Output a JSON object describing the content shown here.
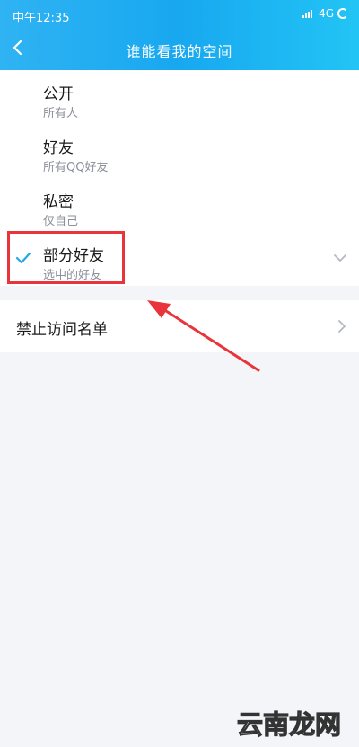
{
  "status_bar": {
    "time": "中午12:35",
    "network": "4G"
  },
  "header": {
    "title": "谁能看我的空间"
  },
  "options": [
    {
      "label": "公开",
      "description": "所有人",
      "selected": false
    },
    {
      "label": "好友",
      "description": "所有QQ好友",
      "selected": false
    },
    {
      "label": "私密",
      "description": "仅自己",
      "selected": false
    },
    {
      "label": "部分好友",
      "description": "选中的好友",
      "selected": true
    }
  ],
  "blacklist": {
    "label": "禁止访问名单"
  },
  "watermark": {
    "text": "云南龙网"
  },
  "colors": {
    "header_start": "#2fb3f3",
    "header_end": "#22c4f5",
    "check": "#21a9e6",
    "annotation": "#e8343a",
    "background": "#f3f5f9"
  },
  "icons": [
    "signal-icon",
    "loading-icon",
    "back-arrow-icon",
    "check-icon",
    "chevron-down-icon",
    "chevron-right-icon"
  ]
}
